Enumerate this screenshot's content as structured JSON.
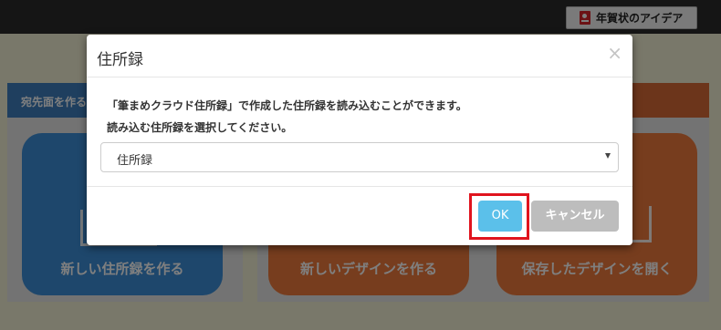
{
  "topbar": {
    "idea_button_label": "年賀状のアイデア",
    "idea_icon": "postcard-icon"
  },
  "background": {
    "left_panel_title": "宛先面を作る",
    "cards": [
      {
        "label": "新しい住所録を作る",
        "color": "#3c8fd9"
      },
      {
        "label": "新しいデザインを作る",
        "color": "#ef7b3c"
      },
      {
        "label": "保存したデザインを開く",
        "color": "#ef7b3c"
      }
    ]
  },
  "modal": {
    "title": "住所録",
    "close_label": "×",
    "message_line1": "「筆まめクラウド住所録」で作成した住所録を読み込むことができます。",
    "message_line2": "読み込む住所録を選択してください。",
    "select_value": "住所録",
    "ok_label": "OK",
    "cancel_label": "キャンセル"
  },
  "colors": {
    "ok": "#5bc0ea",
    "cancel": "#bdbdbd",
    "highlight": "#e0141e"
  }
}
